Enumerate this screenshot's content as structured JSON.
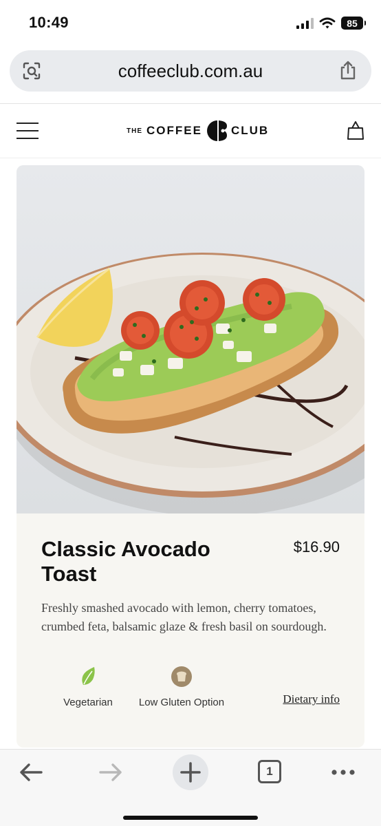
{
  "status_bar": {
    "time": "10:49",
    "battery": "85",
    "icons": [
      "cellular-signal-icon",
      "wifi-icon",
      "battery-icon"
    ]
  },
  "browser": {
    "url": "coffeeclub.com.au",
    "icons": [
      "lens-icon",
      "share-icon"
    ]
  },
  "site_header": {
    "logo": {
      "the": "THE",
      "coffee": "COFFEE",
      "club": "CLUB"
    },
    "icons": [
      "hamburger-menu-icon",
      "shopping-bag-icon"
    ]
  },
  "product": {
    "title": "Classic Avocado Toast",
    "price": "$16.90",
    "description": "Freshly smashed avocado with lemon, cherry tomatoes, crumbed feta, balsamic glaze & fresh basil on sourdough.",
    "dietary": [
      {
        "label": "Vegetarian",
        "icon": "leaf-icon"
      },
      {
        "label": "Low Gluten Option",
        "icon": "bread-icon"
      }
    ],
    "dietary_link": "Dietary info"
  },
  "toolbar": {
    "tabs_count": "1",
    "icons": [
      "back-arrow-icon",
      "forward-arrow-icon",
      "plus-icon",
      "tabs-icon",
      "more-icon"
    ]
  },
  "colors": {
    "card_background": "#f7f6f2",
    "address_bar": "#e9ebee",
    "leaf_green": "#8bc34a",
    "bread_tan": "#a08a6a"
  }
}
